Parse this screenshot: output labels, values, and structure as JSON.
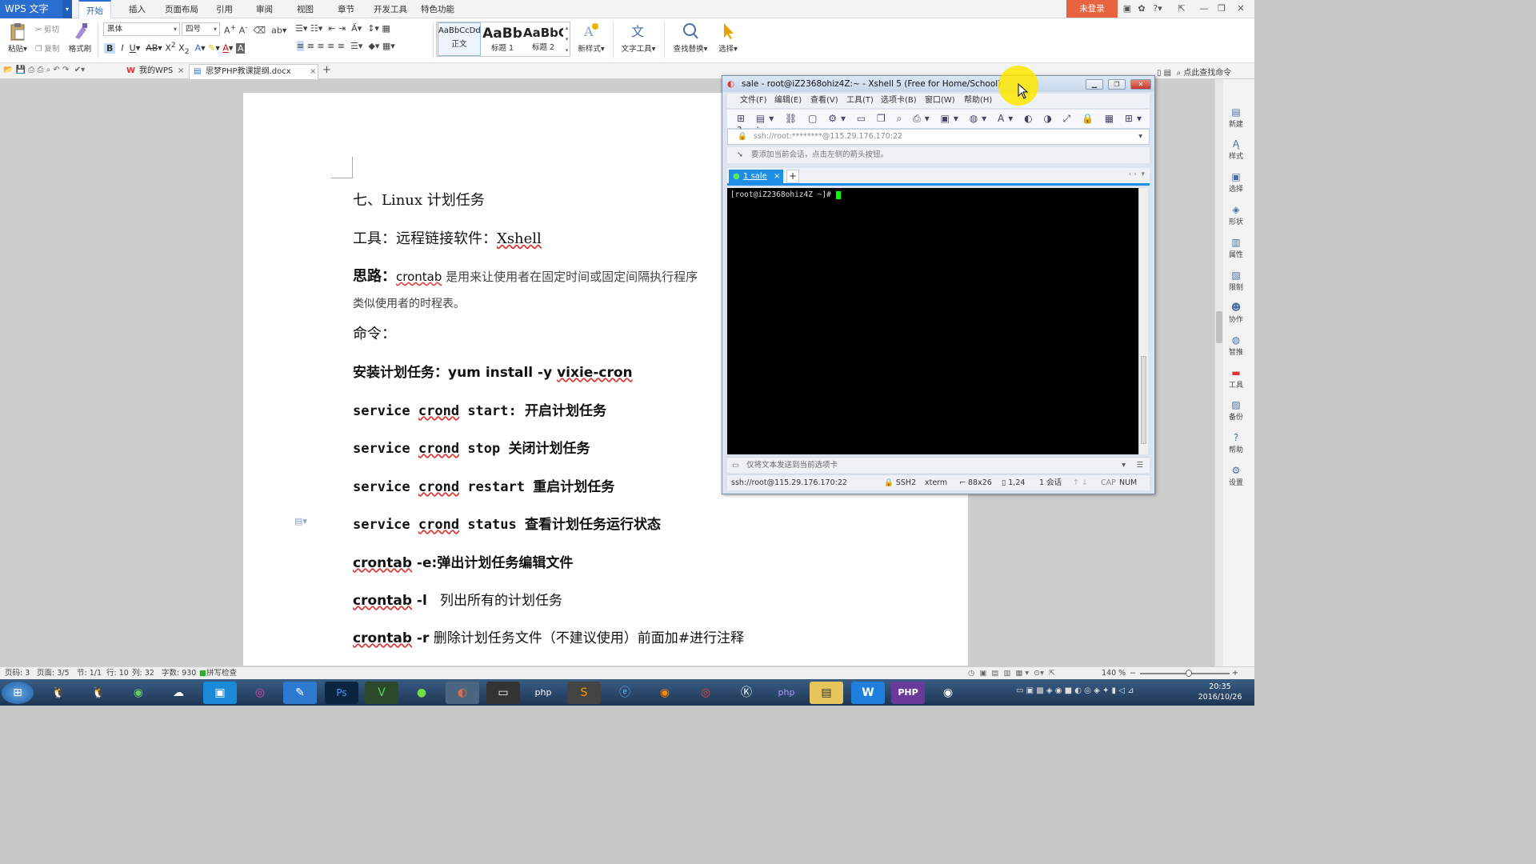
{
  "app": {
    "name": "WPS 文字",
    "login_label": "未登录",
    "menu_tabs": [
      "开始",
      "插入",
      "页面布局",
      "引用",
      "审阅",
      "视图",
      "章节",
      "开发工具",
      "特色功能"
    ],
    "active_tab": "开始",
    "title_icons": [
      "skin-icon",
      "gift-icon",
      "help-icon",
      "restore-icon",
      "minimize-icon",
      "maximize-icon",
      "close-icon"
    ]
  },
  "ribbon": {
    "paste": "粘贴",
    "cut": "剪切",
    "copy": "复制",
    "format_painter": "格式刷",
    "font_name": "黑体",
    "font_size": "四号",
    "styles": [
      {
        "preview": "AaBbCcDd",
        "name": "正文"
      },
      {
        "preview": "AaBb",
        "name": "标题 1"
      },
      {
        "preview": "AaBbC",
        "name": "标题 2"
      }
    ],
    "new_style": "新样式",
    "text_tools": "文字工具",
    "find_replace": "查找替换",
    "select": "选择"
  },
  "tabs_bar": {
    "my_wps": "我的WPS",
    "doc_tab": "思梦PHP教课提纲.docx",
    "search_hint": "点此查找命令"
  },
  "document": {
    "heading": "七、Linux 计划任务",
    "tool_label": "工具：远程链接软件：",
    "tool_value": "Xshell",
    "idea_label": "思路：",
    "idea_crontab": "crontab",
    "idea_text": " 是用来让使用者在固定时间或固定间隔执行程序",
    "idea_text2": "类似使用者的时程表。",
    "cmd_label": "命令：",
    "install_label": "安装计划任务：",
    "install_cmd": "yum install -y ",
    "install_pkg": "vixie-cron",
    "lines": [
      {
        "pre": "service ",
        "word": "crond",
        "post": " start: ",
        "desc": "开启计划任务"
      },
      {
        "pre": "service ",
        "word": "crond",
        "post": " stop ",
        "desc": "关闭计划任务"
      },
      {
        "pre": "service ",
        "word": "crond",
        "post": " restart ",
        "desc": "重启计划任务"
      },
      {
        "pre": "service ",
        "word": "crond",
        "post": " status ",
        "desc": "查看计划任务运行状态"
      }
    ],
    "crontab_lines": [
      {
        "word": "crontab",
        "flag": " -e:",
        "desc": "弹出计划任务编辑文件"
      },
      {
        "word": "crontab",
        "flag": " -l",
        "desc": "   列出所有的计划任务"
      },
      {
        "word": "crontab",
        "flag": " -r",
        "desc": " 删除计划任务文件（不建议使用）前面加#进行注释"
      }
    ]
  },
  "sidebar": {
    "items": [
      "新建",
      "样式",
      "选择",
      "形状",
      "属性",
      "限制",
      "协作",
      "智推",
      "工具",
      "备份",
      "帮助",
      "设置"
    ]
  },
  "statusbar": {
    "page_code": "页码: 3",
    "pages": "页面: 3/5",
    "section": "节: 1/1",
    "row": "行: 10",
    "col": "列: 32",
    "words": "字数: 930",
    "spell": "拼写检查",
    "zoom": "140 %"
  },
  "xshell": {
    "title": "sale - root@iZ2368ohiz4Z:~ - Xshell 5 (Free for Home/School)",
    "menu": [
      "文件(F)",
      "编辑(E)",
      "查看(V)",
      "工具(T)",
      "选项卡(B)",
      "窗口(W)",
      "帮助(H)"
    ],
    "address": "ssh://root:********@115.29.176.170:22",
    "hint": "要添加当前会话，点击左侧的箭头按钮。",
    "tab_label": "1 sale",
    "prompt": "[root@iZ2368ohiz4Z ~]# ",
    "send_hint": "仅将文本发送到当前选项卡",
    "status": {
      "conn": "ssh://root@115.29.176.170:22",
      "proto": "SSH2",
      "term": "xterm",
      "size": "88x26",
      "pos": "1,24",
      "sessions": "1 会话",
      "cap": "CAP",
      "num": "NUM"
    }
  },
  "taskbar": {
    "time": "20:35",
    "date": "2016/10/26",
    "apps": [
      "windows-start",
      "qq",
      "qq-alt",
      "wechat",
      "network-disk",
      "app-2",
      "app-3",
      "app-4",
      "photoshop",
      "vim",
      "browser-green",
      "shell",
      "terminal",
      "php",
      "sublime",
      "ie",
      "firefox",
      "chrome",
      "k-app",
      "php-storm",
      "explorer",
      "wps",
      "php-study",
      "obs"
    ]
  },
  "colors": {
    "accent_blue": "#2b6fd6",
    "login_orange": "#e8633f",
    "xshell_tab": "#1f8fe6",
    "squiggle": "#d33"
  }
}
